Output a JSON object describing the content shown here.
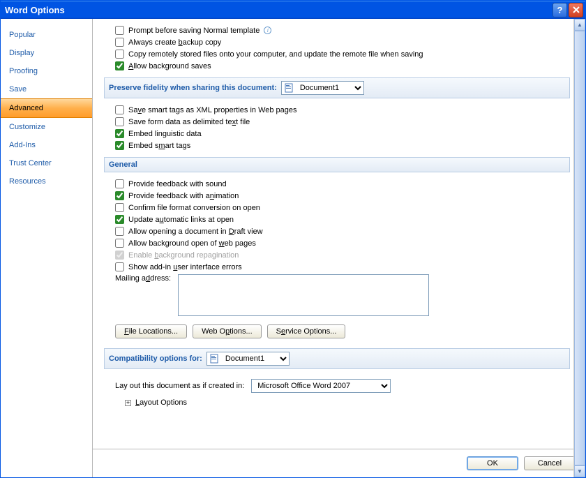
{
  "titlebar": {
    "title": "Word Options"
  },
  "sidebar": {
    "items": [
      {
        "label": "Popular"
      },
      {
        "label": "Display"
      },
      {
        "label": "Proofing"
      },
      {
        "label": "Save"
      },
      {
        "label": "Advanced"
      },
      {
        "label": "Customize"
      },
      {
        "label": "Add-Ins"
      },
      {
        "label": "Trust Center"
      },
      {
        "label": "Resources"
      }
    ],
    "selected_index": 4
  },
  "save_section": {
    "prompt_normal": "Prompt before saving Normal template",
    "backup": "Always create backup copy",
    "copy_remote": "Copy remotely stored files onto your computer, and update the remote file when saving",
    "background_saves": "Allow background saves"
  },
  "preserve": {
    "header": "Preserve fidelity when sharing this document:",
    "document": "Document1",
    "smart_tags_xml": "Save smart tags as XML properties in Web pages",
    "form_data": "Save form data as delimited text file",
    "linguistic": "Embed linguistic data",
    "embed_smart": "Embed smart tags"
  },
  "general": {
    "header": "General",
    "sound": "Provide feedback with sound",
    "animation": "Provide feedback with animation",
    "confirm_convert": "Confirm file format conversion on open",
    "auto_links": "Update automatic links at open",
    "draft_view": "Allow opening a document in Draft view",
    "bg_web": "Allow background open of web pages",
    "repagination": "Enable background repagination",
    "addin_errors": "Show add-in user interface errors",
    "mailing_label": "Mailing address:"
  },
  "buttons": {
    "file_locations": "File Locations...",
    "web_options": "Web Options...",
    "service_options": "Service Options..."
  },
  "compat": {
    "header": "Compatibility options for:",
    "document": "Document1",
    "layout_label": "Lay out this document as if created in:",
    "layout_value": "Microsoft Office Word 2007",
    "layout_options": "Layout Options"
  },
  "footer": {
    "ok": "OK",
    "cancel": "Cancel"
  }
}
